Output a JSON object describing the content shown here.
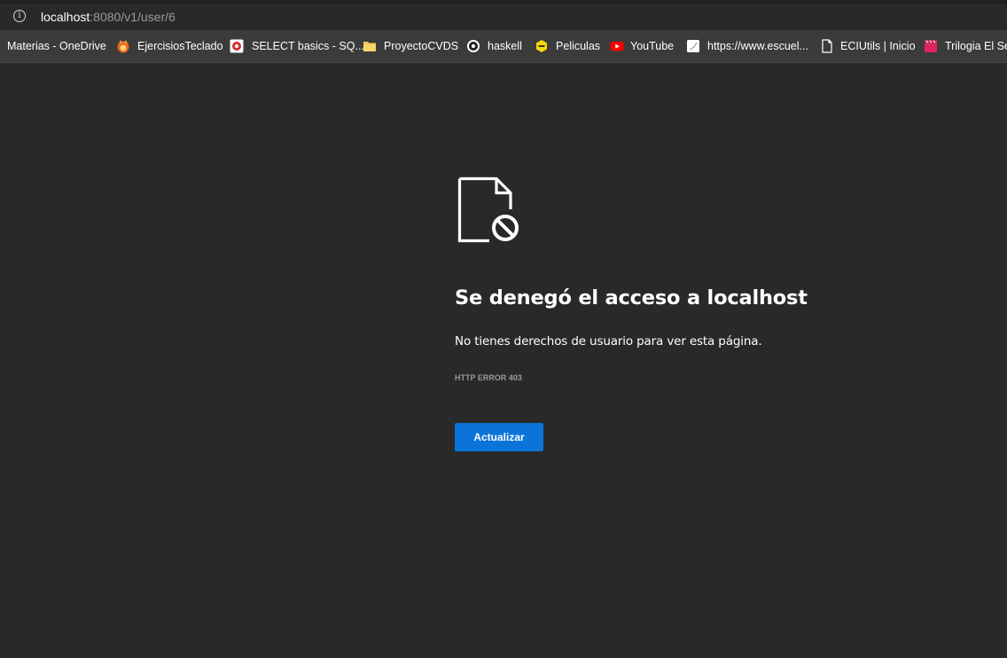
{
  "address_bar": {
    "url_host": "localhost",
    "url_rest": ":8080/v1/user/6",
    "info_icon": "info-icon"
  },
  "bookmarks": [
    {
      "label": "Materias - OneDrive",
      "icon": "none"
    },
    {
      "label": "EjercisiosTeclado",
      "icon": "fox-icon",
      "color": "#f08a24"
    },
    {
      "label": "SELECT basics - SQ...",
      "icon": "sqlzoo-icon",
      "color": "#d42a2a"
    },
    {
      "label": "ProyectoCVDS",
      "icon": "folder-icon",
      "color": "#f2c94c"
    },
    {
      "label": "haskell",
      "icon": "haskell-icon",
      "color": "#ffffff"
    },
    {
      "label": "Peliculas",
      "icon": "hexagon-icon",
      "color": "#f5d90a"
    },
    {
      "label": "YouTube",
      "icon": "youtube-icon",
      "color": "#ff0000"
    },
    {
      "label": "https://www.escuel...",
      "icon": "page-icon",
      "color": "#ffffff"
    },
    {
      "label": "ECIUtils | Inicio",
      "icon": "document-icon",
      "color": "#ffffff"
    },
    {
      "label": "Trilogia El Señ",
      "icon": "clapperboard-icon",
      "color": "#e0245e"
    }
  ],
  "error_page": {
    "icon": "blocked-document-icon",
    "title": "Se denegó el acceso a localhost",
    "description": "No tienes derechos de usuario para ver esta página.",
    "error_code": "HTTP ERROR 403",
    "reload_label": "Actualizar"
  },
  "colors": {
    "background": "#292929",
    "accent_button": "#0a74d8"
  }
}
